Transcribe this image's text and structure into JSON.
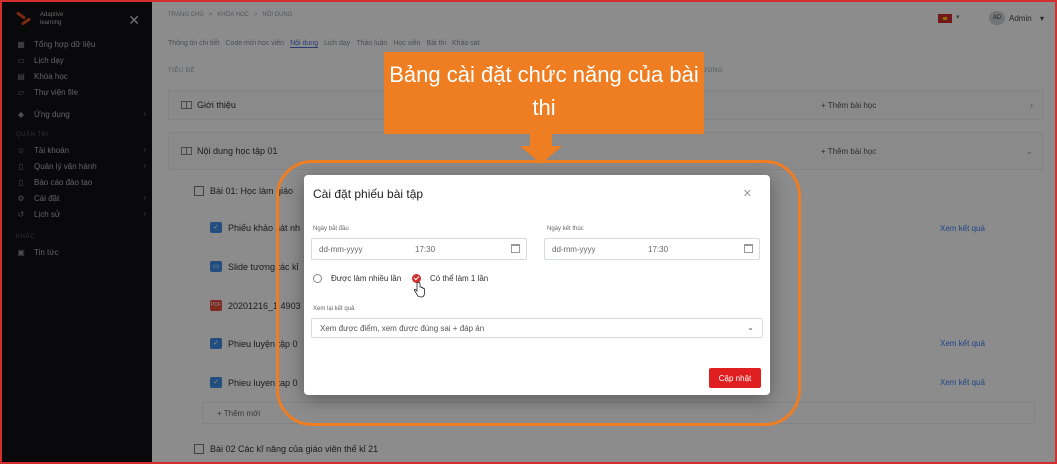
{
  "sidebar": {
    "logo": "Adaptive learning",
    "items": [
      {
        "label": "Tổng hợp dữ liệu",
        "icon": "grid-icon"
      },
      {
        "label": "Lịch dạy",
        "icon": "calendar-icon"
      },
      {
        "label": "Khóa học",
        "icon": "book-icon"
      },
      {
        "label": "Thư viện file",
        "icon": "folder-icon"
      },
      {
        "label": "Ứng dụng",
        "icon": "apps-icon"
      }
    ],
    "section_admin": "QUẢN TRỊ",
    "admin_items": [
      {
        "label": "Tài khoản",
        "icon": "user-icon"
      },
      {
        "label": "Quản lý vận hành",
        "icon": "document-icon"
      },
      {
        "label": "Báo cáo đào tạo",
        "icon": "report-icon"
      },
      {
        "label": "Cài đặt",
        "icon": "gear-icon"
      },
      {
        "label": "Lịch sử",
        "icon": "history-icon"
      }
    ],
    "section_other": "KHÁC",
    "other_items": [
      {
        "label": "Tin tức",
        "icon": "news-icon"
      }
    ]
  },
  "header": {
    "breadcrumb": [
      "TRANG CHỦ",
      "KHÓA HỌC",
      "NỘI DUNG"
    ],
    "breadcrumb_sep": ">",
    "user_initials": "AD",
    "user_name": "Admin",
    "tabs": [
      "Thông tin chi tiết",
      "Code mời học viên",
      "Nội dung",
      "Lịch dạy",
      "Thảo luận",
      "Học viên",
      "Bài thi",
      "Khảo sát"
    ]
  },
  "table": {
    "col_title": "TIÊU ĐỀ",
    "col_content": "LƯỢNG",
    "sections": [
      {
        "title": "Giới thiệu",
        "add": "+ Thêm bài học"
      },
      {
        "title": "Nội dung học tập 01",
        "add": "+ Thêm bài học"
      }
    ],
    "lesson1": "Bài 01: Học làm giáo",
    "items": [
      {
        "title": "Phiếu khảo sát nh",
        "action": "Xem kết quả"
      },
      {
        "title": "Slide tương tác kỉ"
      },
      {
        "title": "20201216_1 4903",
        "file_type": "PDF"
      },
      {
        "title": "Phieu luyện tập 0",
        "action": "Xem kết quả"
      },
      {
        "title": "Phieu luyen tap 0",
        "action": "Xem kết quả"
      }
    ],
    "add_new": "+ Thêm mới",
    "lesson2": "Bài 02 Các kĩ năng của giáo viên thế kỉ 21"
  },
  "modal": {
    "title": "Cài đặt phiếu bài tập",
    "start_label": "Ngày bắt đầu",
    "end_label": "Ngày kết thúc",
    "date_placeholder": "dd-mm-yyyy",
    "start_time": "17:30",
    "end_time": "17:30",
    "radio_multi": "Được làm nhiều lần",
    "radio_once": "Có thể làm 1 lần",
    "review_label": "Xem lại kết quả",
    "review_value": "Xem được điểm, xem được đúng sai + đáp án",
    "submit": "Cập nhật"
  },
  "annotation": {
    "callout_text": "Bảng cài đặt chức năng của bài thi",
    "callout_color": "#ef7d22"
  }
}
